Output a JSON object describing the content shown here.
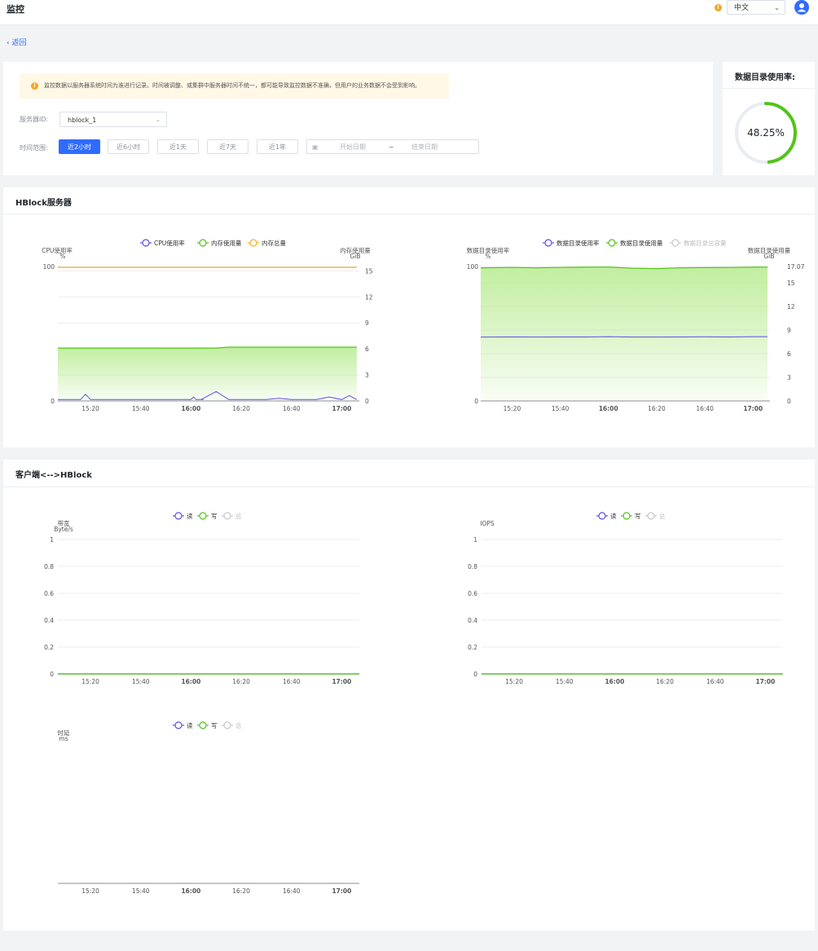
{
  "header": {
    "title": "监控",
    "language": "中文"
  },
  "back_link": "返回",
  "notice": {
    "text": "监控数据以服务器系统时间为准进行记录。时间被调整、或集群中服务器时间不统一，都可能导致监控数据不准确，但用户的业务数据不会受到影响。"
  },
  "filters": {
    "server_label": "服务器ID:",
    "server_value": "hblock_1",
    "time_label": "时间范围:",
    "time_buttons": [
      "近2小时",
      "近6小时",
      "近1天",
      "近7天",
      "近1年"
    ],
    "active_index": 0,
    "start_placeholder": "开始日期",
    "range_separator": "~",
    "end_placeholder": "结束日期"
  },
  "usage": {
    "title": "数据目录使用率:",
    "percent_text": "48.25%",
    "value": 48.25
  },
  "sections": {
    "hblock": "HBlock服务器",
    "client": "客户端<-->HBlock"
  },
  "colors": {
    "primary": "#2f6bff",
    "cpu": "#5b4fe8",
    "memory": "#52c41a",
    "total": "#f0b323",
    "disabled": "#c8c8c8"
  },
  "x_ticks": [
    "15:20",
    "15:40",
    "16:00",
    "16:20",
    "16:40",
    "17:00"
  ],
  "chart_data": [
    {
      "type": "line",
      "name": "hblock-cpu-memory",
      "legend": [
        "CPU使用率",
        "内存使用量",
        "内存总量"
      ],
      "y_left_label": "CPU使用率",
      "y_left_unit": "%",
      "y_right_label": "内存使用量",
      "y_right_unit": "GiB",
      "y_left_ticks": [
        "100",
        "0"
      ],
      "y_right_ticks": [
        "15",
        "12",
        "9",
        "6",
        "3",
        "0"
      ],
      "ylim_left": [
        0,
        100
      ],
      "ylim_right": [
        0,
        15.5
      ],
      "x": [
        "15:07",
        "15:10",
        "15:13",
        "15:16",
        "15:18",
        "15:20",
        "15:22",
        "15:25",
        "15:30",
        "15:35",
        "15:40",
        "15:45",
        "15:50",
        "15:55",
        "16:00",
        "16:01",
        "16:02",
        "16:05",
        "16:04",
        "16:10",
        "16:15",
        "16:20",
        "16:25",
        "16:30",
        "16:35",
        "16:40",
        "16:45",
        "16:50",
        "16:55",
        "17:00",
        "17:03",
        "17:06"
      ],
      "series": [
        {
          "name": "CPU使用率",
          "values": [
            1,
            1,
            1,
            1,
            5,
            1,
            1,
            1,
            1,
            1,
            1,
            1,
            1,
            1,
            1,
            3,
            1,
            1,
            1,
            7,
            1,
            1,
            1,
            1,
            2,
            1,
            1,
            1,
            3,
            1,
            4,
            1
          ]
        },
        {
          "name": "内存使用量",
          "values": [
            6.1,
            6.1,
            6.1,
            6.1,
            6.1,
            6.1,
            6.1,
            6.1,
            6.1,
            6.1,
            6.1,
            6.1,
            6.1,
            6.1,
            6.1,
            6.1,
            6.1,
            6.1,
            6.1,
            6.1,
            6.2,
            6.2,
            6.2,
            6.2,
            6.2,
            6.2,
            6.2,
            6.2,
            6.2,
            6.2,
            6.2,
            6.2
          ]
        },
        {
          "name": "内存总量",
          "values": [
            15.4,
            15.4,
            15.4,
            15.4,
            15.4,
            15.4,
            15.4,
            15.4,
            15.4,
            15.4,
            15.4,
            15.4,
            15.4,
            15.4,
            15.4,
            15.4,
            15.4,
            15.4,
            15.4,
            15.4,
            15.4,
            15.4,
            15.4,
            15.4,
            15.4,
            15.4,
            15.4,
            15.4,
            15.4,
            15.4,
            15.4,
            15.4
          ]
        }
      ]
    },
    {
      "type": "line",
      "name": "data-dir-usage",
      "legend": [
        "数据目录使用率",
        "数据目录使用量",
        "数据目录总容量"
      ],
      "y_left_label": "数据目录使用率",
      "y_left_unit": "%",
      "y_right_label": "数据目录使用量",
      "y_right_unit": "GiB",
      "y_left_ticks": [
        "100",
        "0"
      ],
      "y_right_ticks": [
        "17.07",
        "15",
        "12",
        "9",
        "6",
        "3",
        "0"
      ],
      "ylim_left": [
        0,
        100
      ],
      "ylim_right": [
        0,
        17.07
      ],
      "x": [
        "15:07",
        "15:20",
        "15:30",
        "15:40",
        "15:50",
        "16:00",
        "16:10",
        "16:20",
        "16:30",
        "16:40",
        "16:50",
        "17:00",
        "17:06"
      ],
      "series": [
        {
          "name": "数据目录使用率",
          "values": [
            47.5,
            47.6,
            47.5,
            47.6,
            47.6,
            47.8,
            47.5,
            47.5,
            47.6,
            47.7,
            47.6,
            47.8,
            47.8
          ]
        },
        {
          "name": "数据目录使用量",
          "values": [
            16.9,
            16.95,
            16.9,
            16.95,
            16.98,
            17.0,
            16.85,
            16.8,
            16.9,
            16.93,
            16.95,
            16.98,
            17.0
          ]
        }
      ]
    },
    {
      "type": "line",
      "name": "bandwidth",
      "legend": [
        "读",
        "写",
        "总"
      ],
      "y_label": "带宽",
      "y_unit": "Byte/s",
      "y_ticks": [
        "1",
        "0.8",
        "0.6",
        "0.4",
        "0.2",
        "0"
      ],
      "ylim": [
        0,
        1
      ],
      "series": [
        {
          "name": "读",
          "values": [
            0,
            0
          ]
        },
        {
          "name": "写",
          "values": [
            0,
            0
          ]
        }
      ]
    },
    {
      "type": "line",
      "name": "iops",
      "legend": [
        "读",
        "写",
        "总"
      ],
      "y_label": "IOPS",
      "y_ticks": [
        "1",
        "0.8",
        "0.6",
        "0.4",
        "0.2",
        "0"
      ],
      "ylim": [
        0,
        1
      ],
      "series": [
        {
          "name": "读",
          "values": [
            0,
            0
          ]
        },
        {
          "name": "写",
          "values": [
            0,
            0
          ]
        }
      ]
    },
    {
      "type": "line",
      "name": "latency",
      "legend": [
        "读",
        "写",
        "总"
      ],
      "y_label": "时延",
      "y_unit": "ms",
      "y_ticks": [],
      "series": []
    }
  ]
}
